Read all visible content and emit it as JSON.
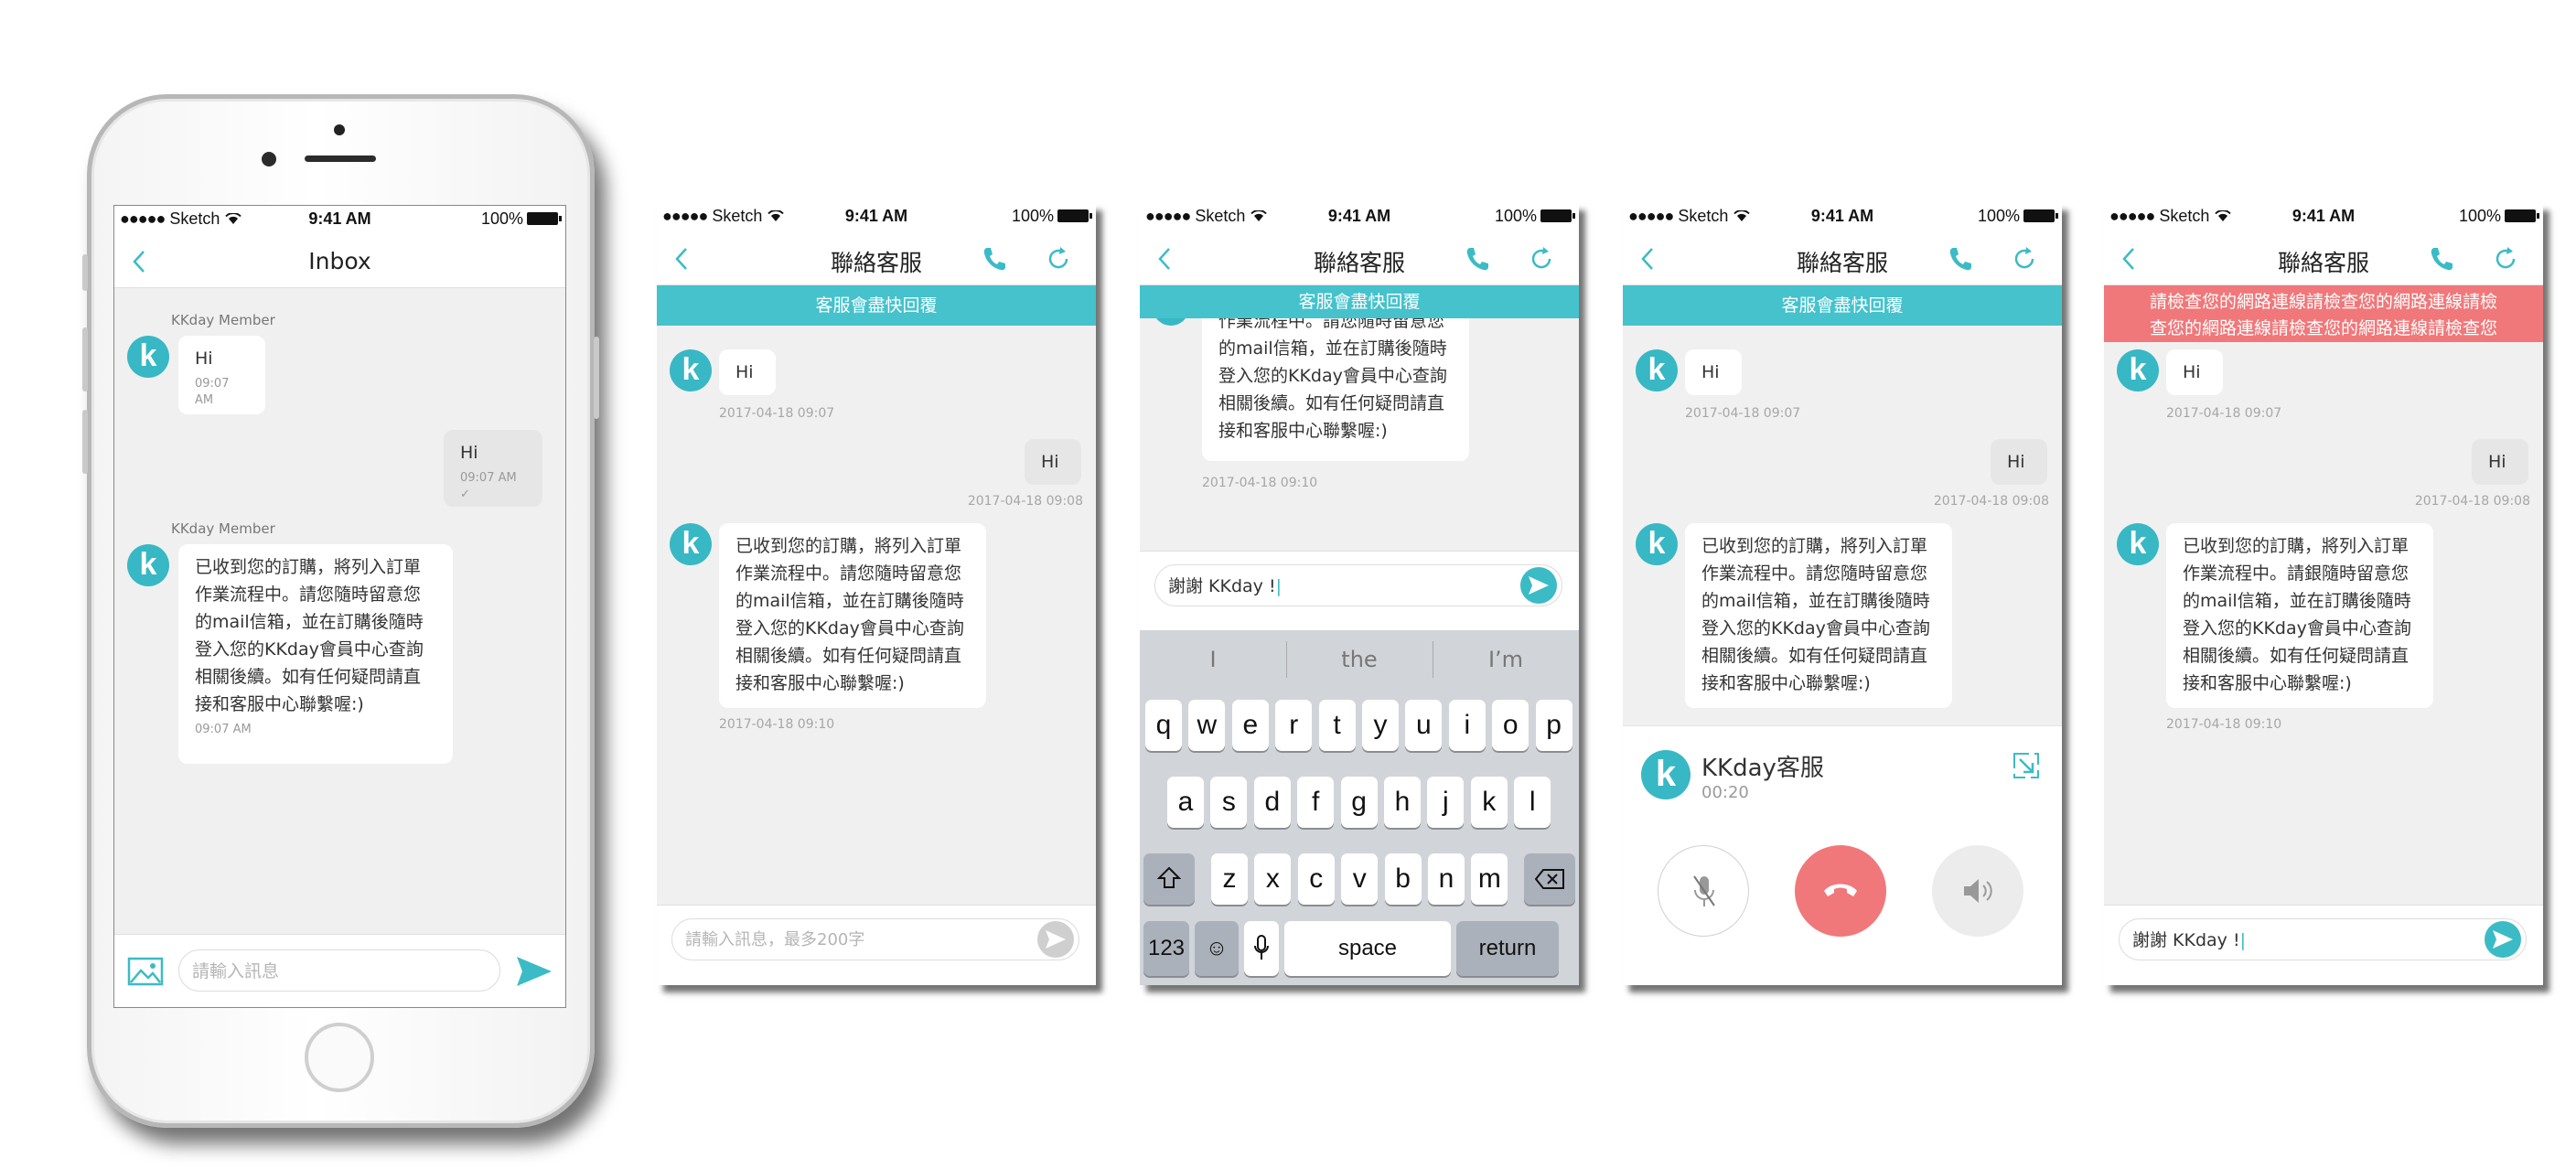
{
  "status": {
    "carrier": "Sketch",
    "time": "9:41 AM",
    "battery": "100%"
  },
  "colors": {
    "accent": "#45c2cc",
    "error_banner": "#f0787a",
    "hangup": "#f0787a"
  },
  "inbox": {
    "title": "Inbox",
    "messages": [
      {
        "sender": "KKday Member",
        "text": "Hi",
        "time": "09:07 AM"
      },
      {
        "text": "Hi",
        "time": "09:07 AM"
      },
      {
        "sender": "KKday Member",
        "lines": [
          "已收到您的訂購，將列入訂單",
          "作業流程中。請您隨時留意您",
          "的mail信箱，並在訂購後隨時",
          "登入您的KKday會員中心查詢",
          "相關後續。如有任何疑問請直",
          "接和客服中心聯繫喔:)"
        ],
        "time": "09:07 AM"
      }
    ],
    "input_placeholder": "請輸入訊息"
  },
  "chat": {
    "title": "聯絡客服",
    "banner": "客服會盡快回覆",
    "error_banner_lines": [
      "請檢查您的網路連線請檢查您的網路連線請檢",
      "查您的網路連線請檢查您的網路連線請檢查您"
    ],
    "hi": "Hi",
    "hi_time": "2017-04-18 09:07",
    "reply_time": "2017-04-18 09:08",
    "long_lines": [
      "已收到您的訂購，將列入訂單",
      "作業流程中。請您隨時留意您",
      "的mail信箱，並在訂購後隨時",
      "登入您的KKday會員中心查詢",
      "相關後續。如有任何疑問請直",
      "接和客服中心聯繫喔:)"
    ],
    "long_lines_variant": [
      "已收到您的訂購，將列入訂單",
      "作業流程中。請銀隨時留意您",
      "的mail信箱，並在訂購後隨時",
      "登入您的KKday會員中心查詢",
      "相關後續。如有任何疑問請直",
      "接和客服中心聯繫喔:)"
    ],
    "long_time": "2017-04-18 09:10",
    "input_placeholder": "請輸入訊息，最多200字",
    "typed_text": "謝謝 KKday !"
  },
  "keyboard": {
    "suggestions": [
      "I",
      "the",
      "I’m"
    ],
    "row1": [
      "q",
      "w",
      "e",
      "r",
      "t",
      "y",
      "u",
      "i",
      "o",
      "p"
    ],
    "row2": [
      "a",
      "s",
      "d",
      "f",
      "g",
      "h",
      "j",
      "k",
      "l"
    ],
    "row3": [
      "z",
      "x",
      "c",
      "v",
      "b",
      "n",
      "m"
    ],
    "numbers": "123",
    "space": "space",
    "return": "return"
  },
  "call": {
    "name": "KKday客服",
    "duration": "00:20"
  },
  "avatar_letter": "k"
}
